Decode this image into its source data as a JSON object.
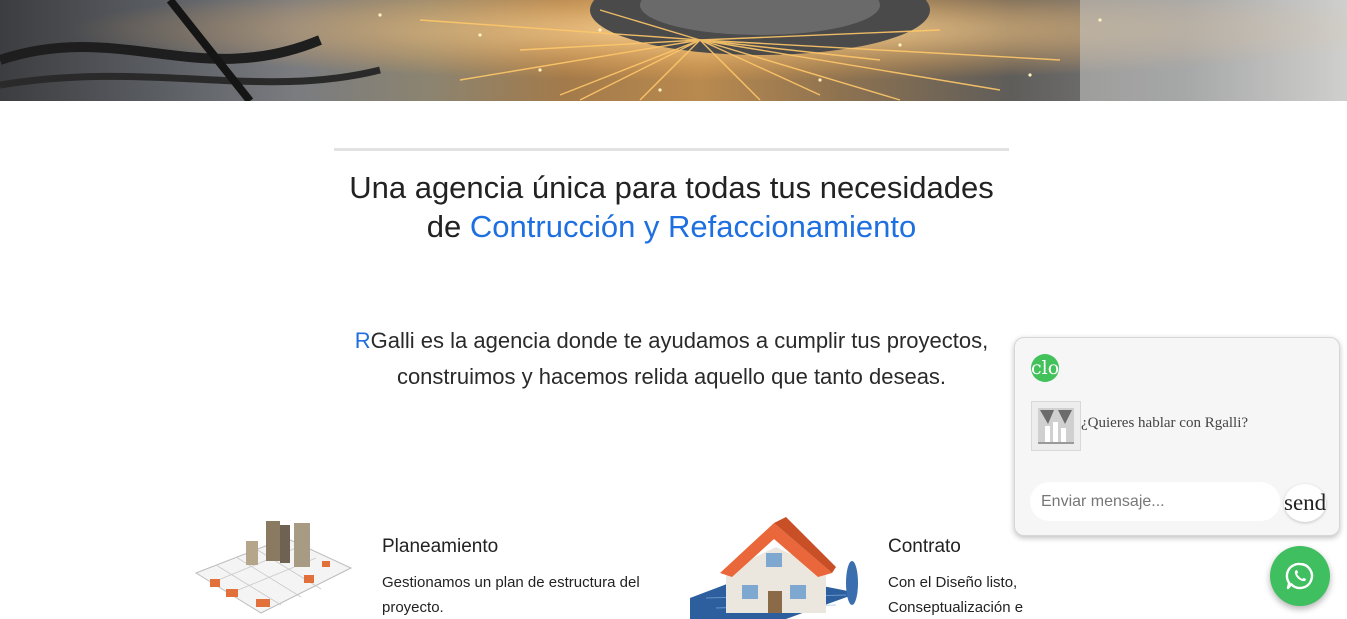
{
  "hero": {
    "image": "angle-grinder-sparks-photo"
  },
  "intro": {
    "headline_start": "Una agencia única para todas tus necesidades de",
    "headline_highlight": "Contrucción y Refaccionamiento",
    "lead_initial": "R",
    "lead_rest": "Galli es la agencia donde te ayudamos a cumplir tus proyectos, construimos y hacemos relida aquello que tanto deseas.",
    "accent_color": "#1e6fe0"
  },
  "features": [
    {
      "icon": "building-blueprint-illustration",
      "title": "Planeamiento",
      "text": "Gestionamos un plan de estructura del proyecto."
    },
    {
      "icon": "house-on-blueprints-illustration",
      "title": "Contrato",
      "text": "Con el Diseño listo, Conseptualización e"
    }
  ],
  "chat": {
    "close_label": "close",
    "avatar_icon": "rgalli-logo",
    "message": "¿Quieres hablar con Rgalli?",
    "input_placeholder": "Enviar mensaje...",
    "send_label": "send",
    "accent_color": "#43c15b"
  },
  "whatsapp": {
    "icon": "whatsapp-icon",
    "color": "#3fbf5f"
  }
}
